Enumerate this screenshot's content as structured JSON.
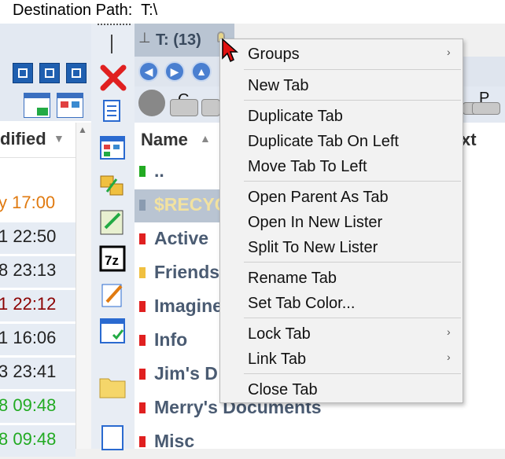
{
  "header": {
    "destination_label": "Destination Path:  T:\\"
  },
  "left_pane": {
    "column_header": "dified",
    "rows": [
      {
        "text": "y 17:00",
        "color": "#e07a10",
        "bg": "#ffffff"
      },
      {
        "text": "1 22:50",
        "color": "#222222",
        "bg": "#e6ecf4"
      },
      {
        "text": "8 23:13",
        "color": "#222222",
        "bg": "#e6ecf4"
      },
      {
        "text": "1 22:12",
        "color": "#8b0000",
        "bg": "#e6ecf4"
      },
      {
        "text": "1 16:06",
        "color": "#222222",
        "bg": "#e6ecf4"
      },
      {
        "text": "3 23:41",
        "color": "#222222",
        "bg": "#e6ecf4"
      },
      {
        "text": "8 09:48",
        "color": "#22aa22",
        "bg": "#e6ecf4"
      },
      {
        "text": "8 09:48",
        "color": "#22aa22",
        "bg": "#e6ecf4"
      }
    ]
  },
  "lister": {
    "tab_label": "T: (13)",
    "drives": {
      "c": "C",
      "p": "P"
    },
    "columns": {
      "name": "Name",
      "ext": "xt"
    },
    "rows": [
      {
        "name": "..",
        "flag": "#22aa22",
        "selected": false
      },
      {
        "name": "$RECYC",
        "flag": "#8a9bb0",
        "selected": true
      },
      {
        "name": "Active",
        "flag": "#e02020",
        "selected": false
      },
      {
        "name": "Friends",
        "flag": "#f0c040",
        "selected": false
      },
      {
        "name": "Imagine",
        "flag": "#e02020",
        "selected": false
      },
      {
        "name": "Info",
        "flag": "#e02020",
        "selected": false
      },
      {
        "name": "Jim's D",
        "flag": "#e02020",
        "selected": false
      },
      {
        "name": "Merry's Documents",
        "flag": "#e02020",
        "selected": false
      },
      {
        "name": "Misc",
        "flag": "#e02020",
        "selected": false
      }
    ]
  },
  "context_menu": {
    "items": [
      {
        "label": "Groups",
        "submenu": "›"
      },
      {
        "label": "New Tab"
      },
      {
        "label": "Duplicate Tab"
      },
      {
        "label": "Duplicate Tab On Left"
      },
      {
        "label": "Move Tab To Left"
      },
      {
        "label": "Open Parent As Tab"
      },
      {
        "label": "Open In New Lister"
      },
      {
        "label": "Split To New Lister"
      },
      {
        "label": "Rename Tab"
      },
      {
        "label": "Set Tab Color..."
      },
      {
        "label": "Lock Tab",
        "submenu": "›"
      },
      {
        "label": "Link Tab",
        "submenu": "›"
      },
      {
        "label": "Close Tab"
      }
    ]
  }
}
